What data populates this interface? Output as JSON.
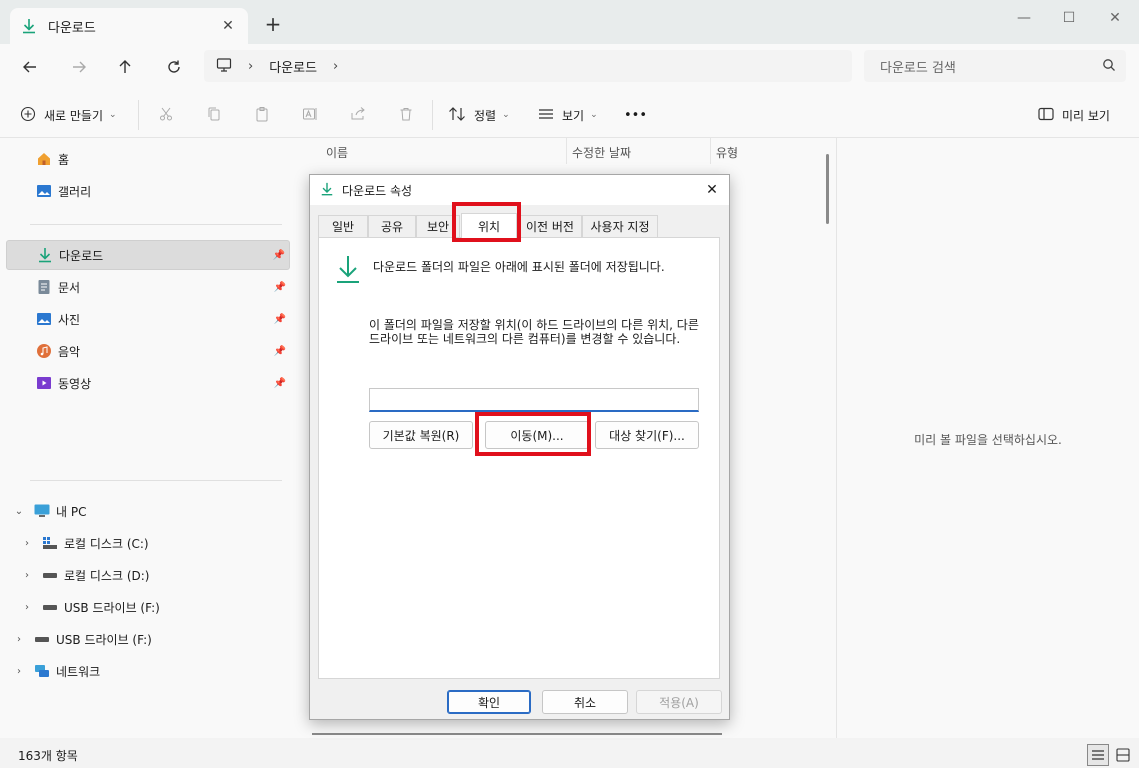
{
  "window": {
    "tab_title": "다운로드",
    "new_tab": "+"
  },
  "nav": {
    "breadcrumb": [
      "다운로드"
    ],
    "search_placeholder": "다운로드 검색"
  },
  "commands": {
    "new": "새로 만들기",
    "sort": "정렬",
    "view": "보기",
    "more": "•••",
    "preview": "미리 보기"
  },
  "sidebar": {
    "quick": [
      {
        "label": "홈",
        "icon": "home-icon"
      },
      {
        "label": "갤러리",
        "icon": "gallery-icon"
      }
    ],
    "pinned": [
      {
        "label": "다운로드",
        "icon": "download-icon",
        "selected": true
      },
      {
        "label": "문서",
        "icon": "document-icon"
      },
      {
        "label": "사진",
        "icon": "picture-icon"
      },
      {
        "label": "음악",
        "icon": "music-icon"
      },
      {
        "label": "동영상",
        "icon": "video-icon"
      }
    ],
    "tree": [
      {
        "label": "내 PC",
        "icon": "pc-icon",
        "expanded": true
      },
      {
        "label": "로컬 디스크 (C:)",
        "icon": "drive-icon"
      },
      {
        "label": "로컬 디스크 (D:)",
        "icon": "drive-icon"
      },
      {
        "label": "USB 드라이브 (F:)",
        "icon": "usb-drive-icon"
      },
      {
        "label": "USB 드라이브 (F:)",
        "icon": "usb-drive-icon"
      },
      {
        "label": "네트워크",
        "icon": "network-icon"
      }
    ]
  },
  "filelist": {
    "columns": [
      "이름",
      "수정한 날짜",
      "유형"
    ]
  },
  "preview_pane": {
    "message": "미리 볼 파일을 선택하십시오."
  },
  "status": {
    "count": "163개 항목"
  },
  "dialog": {
    "title": "다운로드 속성",
    "tabs": [
      "일반",
      "공유",
      "보안",
      "위치",
      "이전 버전",
      "사용자 지정"
    ],
    "active_tab": "위치",
    "text1": "다운로드 폴더의 파일은 아래에 표시된 폴더에 저장됩니다.",
    "text2": "이 폴더의 파일을 저장할 위치(이 하드 드라이브의 다른 위치, 다른 드라이브 또는 네트워크의 다른 컴퓨터)를 변경할 수 있습니다.",
    "path_value": "",
    "btn_restore": "기본값 복원(R)",
    "btn_move": "이동(M)...",
    "btn_find": "대상 찾기(F)...",
    "btn_ok": "확인",
    "btn_cancel": "취소",
    "btn_apply": "적용(A)"
  },
  "colors": {
    "accent": "#2a6bc4",
    "highlight": "#e0101c",
    "download_green": "#1aa37a"
  }
}
